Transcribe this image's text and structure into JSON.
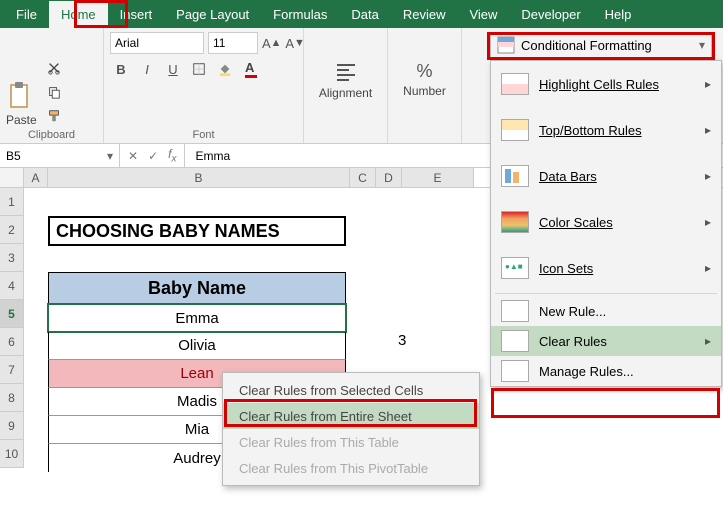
{
  "menu": {
    "file": "File",
    "home": "Home",
    "insert": "Insert",
    "page_layout": "Page Layout",
    "formulas": "Formulas",
    "data": "Data",
    "review": "Review",
    "view": "View",
    "developer": "Developer",
    "help": "Help"
  },
  "ribbon": {
    "clipboard": {
      "label": "Clipboard",
      "paste": "Paste"
    },
    "font": {
      "label": "Font",
      "name": "Arial",
      "size": "11"
    },
    "alignment": {
      "label": "Alignment"
    },
    "number": {
      "label": "Number"
    },
    "cf_button": "Conditional Formatting"
  },
  "namebox": "B5",
  "formula_value": "Emma",
  "cols": {
    "A": "A",
    "B": "B",
    "C": "C",
    "D": "D",
    "E": "E"
  },
  "rows": [
    "1",
    "2",
    "3",
    "4",
    "5",
    "6",
    "7",
    "8",
    "9",
    "10"
  ],
  "title": "CHOOSING BABY NAMES",
  "header": "Baby Name",
  "names": [
    "Emma",
    "Olivia",
    "Lean",
    "Madis",
    "Mia",
    "Audrey"
  ],
  "extra_e6": "3",
  "cf_menu": {
    "highlight": "Highlight Cells Rules",
    "topbottom": "Top/Bottom Rules",
    "databars": "Data Bars",
    "colorscales": "Color Scales",
    "iconsets": "Icon Sets",
    "newrule": "New Rule...",
    "clearrules": "Clear Rules",
    "managerules": "Manage Rules..."
  },
  "clear_sub": {
    "selected": "Clear Rules from Selected Cells",
    "sheet": "Clear Rules from Entire Sheet",
    "table": "Clear Rules from This Table",
    "pivot": "Clear Rules from This PivotTable"
  }
}
